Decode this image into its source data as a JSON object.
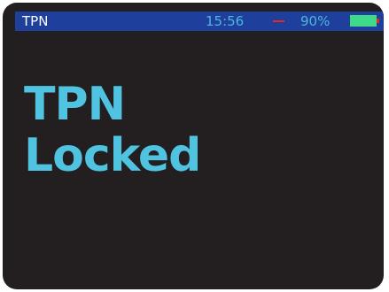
{
  "status_bar": {
    "title": "TPN",
    "time": "15:56",
    "signal_indicator": "—",
    "battery_percent": "90%",
    "battery_level": 0.9,
    "battery_icon": "battery-icon",
    "colors": {
      "bar_background": "#1e3f9c",
      "time_text": "#4fb6d8",
      "signal": "#e8262a",
      "battery_fill": "#3fd98a"
    }
  },
  "main": {
    "message_line1": "TPN",
    "message_line2": "Locked",
    "message_color": "#4fc3e0",
    "screen_background": "#231f20"
  }
}
